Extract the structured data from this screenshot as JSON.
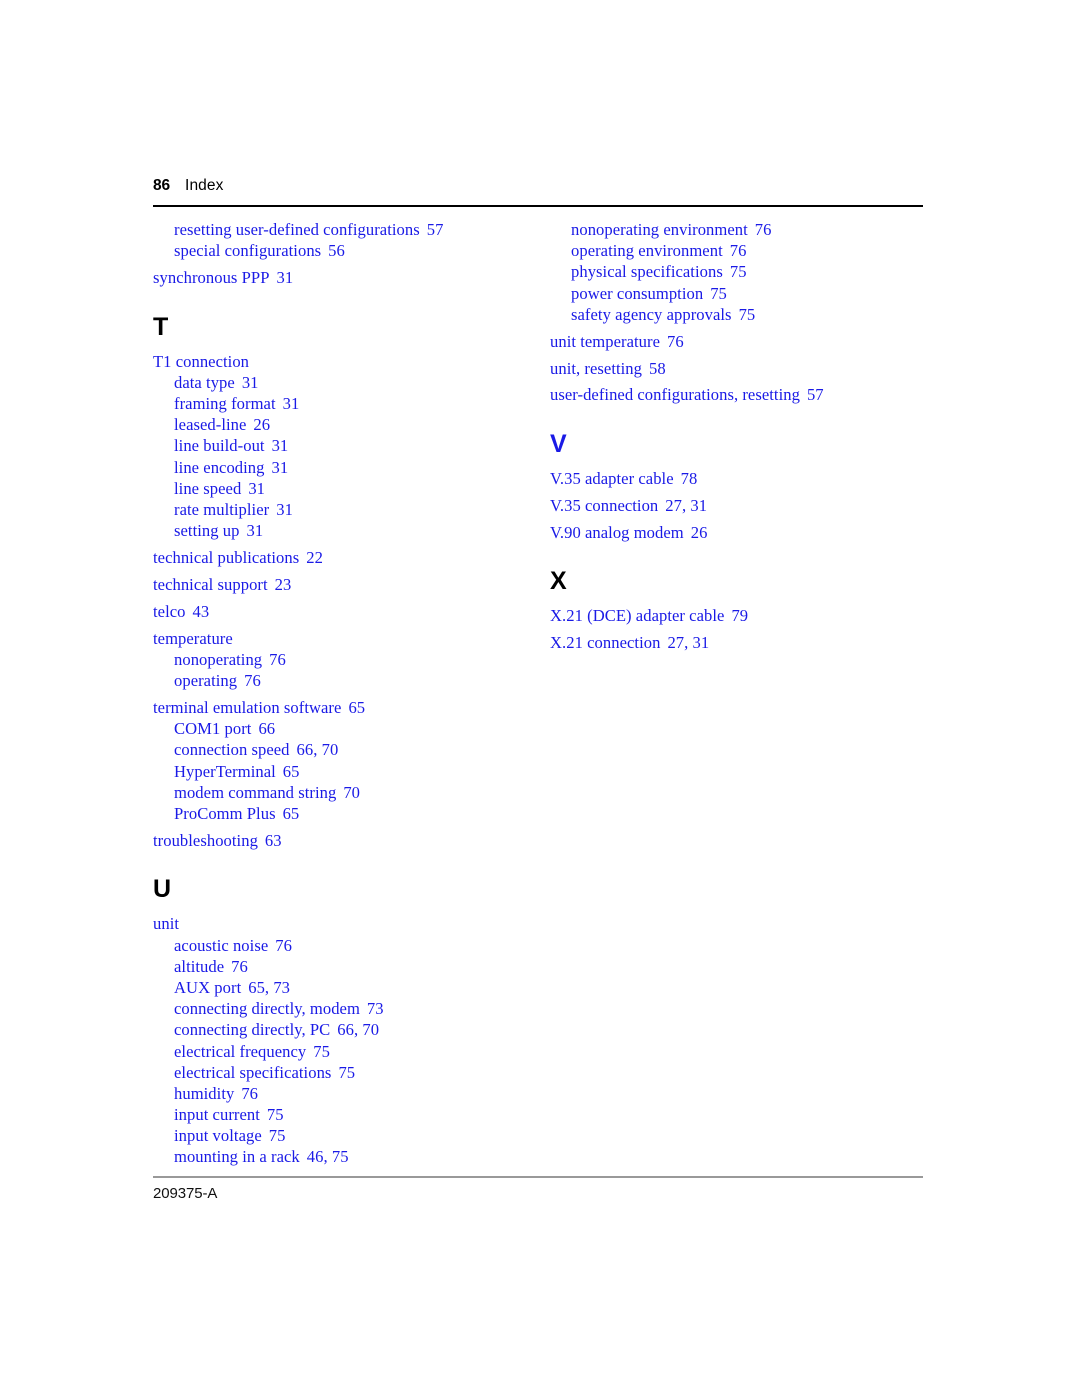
{
  "header": {
    "folio": "86",
    "section_title": "Index"
  },
  "footer": {
    "doc_number": "209375-A"
  },
  "colors": {
    "entry_blue": "#1a1ae6",
    "heading_black": "#000000",
    "head_rule": "#000000",
    "foot_rule": "#999999"
  },
  "columns": {
    "left": [
      {
        "kind": "entry",
        "level": 2,
        "text": "resetting user-defined configurations",
        "pages": "57"
      },
      {
        "kind": "entry",
        "level": 2,
        "text": "special configurations",
        "pages": "56"
      },
      {
        "kind": "entry",
        "level": 1,
        "text": "synchronous PPP",
        "pages": "31"
      },
      {
        "kind": "letter",
        "text": "T",
        "color": "black"
      },
      {
        "kind": "entry",
        "level": 1,
        "text": "T1 connection",
        "pages": ""
      },
      {
        "kind": "entry",
        "level": 2,
        "text": "data type",
        "pages": "31"
      },
      {
        "kind": "entry",
        "level": 2,
        "text": "framing format",
        "pages": "31"
      },
      {
        "kind": "entry",
        "level": 2,
        "text": "leased-line",
        "pages": "26"
      },
      {
        "kind": "entry",
        "level": 2,
        "text": "line build-out",
        "pages": "31"
      },
      {
        "kind": "entry",
        "level": 2,
        "text": "line encoding",
        "pages": "31"
      },
      {
        "kind": "entry",
        "level": 2,
        "text": "line speed",
        "pages": "31"
      },
      {
        "kind": "entry",
        "level": 2,
        "text": "rate multiplier",
        "pages": "31"
      },
      {
        "kind": "entry",
        "level": 2,
        "text": "setting up",
        "pages": "31"
      },
      {
        "kind": "entry",
        "level": 1,
        "text": "technical publications",
        "pages": "22"
      },
      {
        "kind": "entry",
        "level": 1,
        "text": "technical support",
        "pages": "23"
      },
      {
        "kind": "entry",
        "level": 1,
        "text": "telco",
        "pages": "43"
      },
      {
        "kind": "entry",
        "level": 1,
        "text": "temperature",
        "pages": ""
      },
      {
        "kind": "entry",
        "level": 2,
        "text": "nonoperating",
        "pages": "76"
      },
      {
        "kind": "entry",
        "level": 2,
        "text": "operating",
        "pages": "76"
      },
      {
        "kind": "entry",
        "level": 1,
        "text": "terminal emulation software",
        "pages": "65"
      },
      {
        "kind": "entry",
        "level": 2,
        "text": "COM1 port",
        "pages": "66"
      },
      {
        "kind": "entry",
        "level": 2,
        "text": "connection speed",
        "pages": "66, 70"
      },
      {
        "kind": "entry",
        "level": 2,
        "text": "HyperTerminal",
        "pages": "65"
      },
      {
        "kind": "entry",
        "level": 2,
        "text": "modem command string",
        "pages": "70"
      },
      {
        "kind": "entry",
        "level": 2,
        "text": "ProComm Plus",
        "pages": "65"
      },
      {
        "kind": "entry",
        "level": 1,
        "text": "troubleshooting",
        "pages": "63"
      },
      {
        "kind": "letter",
        "text": "U",
        "color": "black"
      },
      {
        "kind": "entry",
        "level": 1,
        "text": "unit",
        "pages": ""
      },
      {
        "kind": "entry",
        "level": 2,
        "text": "acoustic noise",
        "pages": "76"
      },
      {
        "kind": "entry",
        "level": 2,
        "text": "altitude",
        "pages": "76"
      },
      {
        "kind": "entry",
        "level": 2,
        "text": "AUX port",
        "pages": "65, 73"
      },
      {
        "kind": "entry",
        "level": 2,
        "text": "connecting directly, modem",
        "pages": "73"
      },
      {
        "kind": "entry",
        "level": 2,
        "text": "connecting directly, PC",
        "pages": "66, 70"
      },
      {
        "kind": "entry",
        "level": 2,
        "text": "electrical frequency",
        "pages": "75"
      },
      {
        "kind": "entry",
        "level": 2,
        "text": "electrical specifications",
        "pages": "75"
      },
      {
        "kind": "entry",
        "level": 2,
        "text": "humidity",
        "pages": "76"
      },
      {
        "kind": "entry",
        "level": 2,
        "text": "input current",
        "pages": "75"
      },
      {
        "kind": "entry",
        "level": 2,
        "text": "input voltage",
        "pages": "75"
      },
      {
        "kind": "entry",
        "level": 2,
        "text": "mounting in a rack",
        "pages": "46, 75"
      }
    ],
    "right": [
      {
        "kind": "entry",
        "level": 2,
        "text": "nonoperating environment",
        "pages": "76"
      },
      {
        "kind": "entry",
        "level": 2,
        "text": "operating environment",
        "pages": "76"
      },
      {
        "kind": "entry",
        "level": 2,
        "text": "physical specifications",
        "pages": "75"
      },
      {
        "kind": "entry",
        "level": 2,
        "text": "power consumption",
        "pages": "75"
      },
      {
        "kind": "entry",
        "level": 2,
        "text": "safety agency approvals",
        "pages": "75"
      },
      {
        "kind": "entry",
        "level": 1,
        "text": "unit temperature",
        "pages": "76"
      },
      {
        "kind": "entry",
        "level": 1,
        "text": "unit, resetting",
        "pages": "58"
      },
      {
        "kind": "entry",
        "level": 1,
        "text": "user-defined configurations, resetting",
        "pages": "57"
      },
      {
        "kind": "letter",
        "text": "V",
        "color": "blue"
      },
      {
        "kind": "entry",
        "level": 1,
        "text": "V.35 adapter cable",
        "pages": "78"
      },
      {
        "kind": "entry",
        "level": 1,
        "text": "V.35 connection",
        "pages": "27, 31"
      },
      {
        "kind": "entry",
        "level": 1,
        "text": "V.90 analog modem",
        "pages": "26"
      },
      {
        "kind": "letter",
        "text": "X",
        "color": "black"
      },
      {
        "kind": "entry",
        "level": 1,
        "text": "X.21 (DCE) adapter cable",
        "pages": "79"
      },
      {
        "kind": "entry",
        "level": 1,
        "text": "X.21 connection",
        "pages": "27, 31"
      }
    ]
  }
}
